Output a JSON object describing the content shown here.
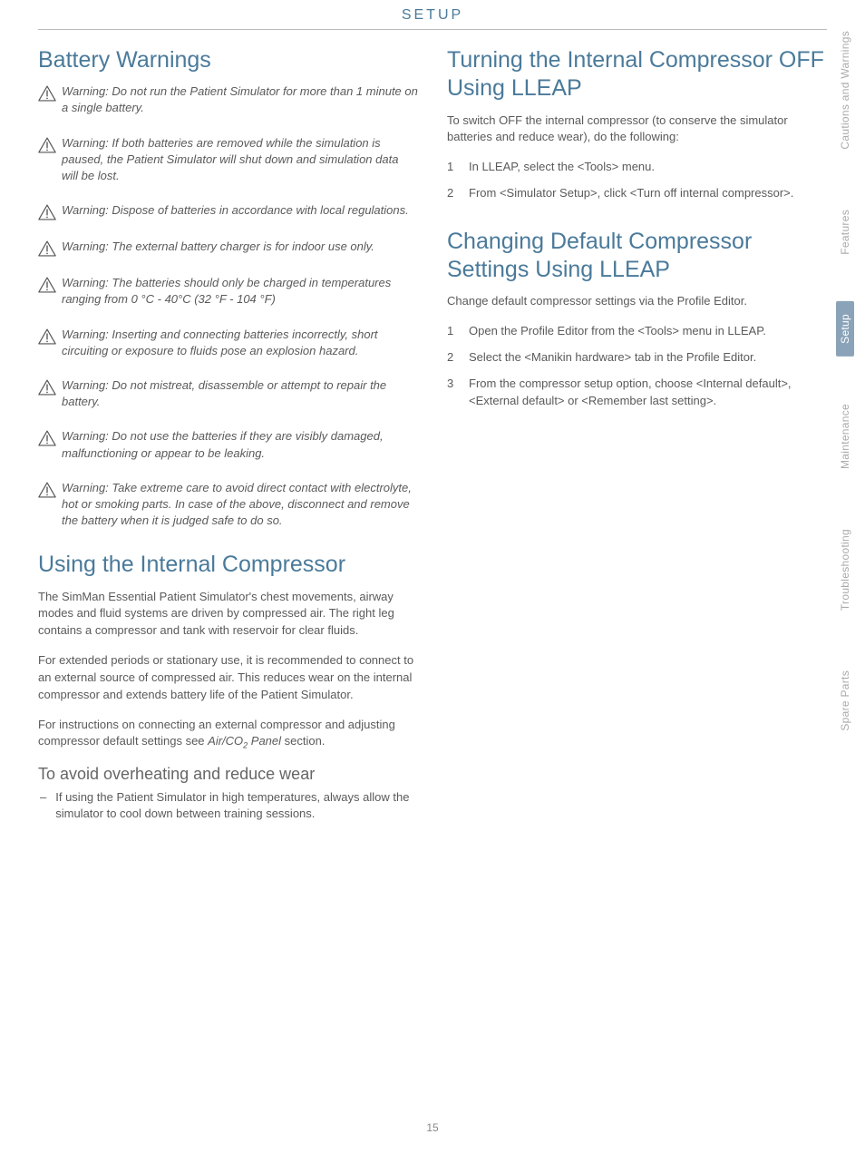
{
  "header": "SETUP",
  "page_number": "15",
  "side_tabs": [
    {
      "label": "Cautions and Warnings",
      "active": false
    },
    {
      "label": "Features",
      "active": false
    },
    {
      "label": "Setup",
      "active": true
    },
    {
      "label": "Maintenance",
      "active": false
    },
    {
      "label": "Troubleshooting",
      "active": false
    },
    {
      "label": "Spare Parts",
      "active": false
    }
  ],
  "left": {
    "h_battery": "Battery Warnings",
    "warnings": [
      "Warning: Do not run the Patient Simulator for more than 1 minute on a single battery.",
      "Warning: If both batteries are removed while the simulation is paused, the Patient Simulator will shut down and simulation data will be lost.",
      "Warning: Dispose of batteries in accordance with local regulations.",
      "Warning: The external battery charger is for indoor use only.",
      "Warning: The batteries should only be charged in temperatures ranging from 0 °C - 40°C (32 °F - 104 °F)",
      "Warning: Inserting and connecting batteries incorrectly, short circuiting or exposure to fluids pose an explosion hazard.",
      "Warning: Do not mistreat, disassemble or attempt to repair the battery.",
      "Warning: Do not use the batteries if they are visibly damaged, malfunctioning or appear to be leaking.",
      "Warning: Take extreme care to avoid direct contact with electrolyte, hot or smoking parts.  In case of the above, disconnect and remove the battery when it is judged safe to do so."
    ],
    "h_internal": "Using the Internal Compressor",
    "p1": "The SimMan Essential Patient Simulator's chest movements, airway modes and fluid systems are driven by compressed air. The right leg contains a compressor and tank with reservoir for clear fluids.",
    "p2": "For extended periods or stationary use, it is recommended to connect to an external source of compressed air. This reduces wear on the internal compressor and extends battery life of the Patient Simulator.",
    "p3_pre": "For instructions on connecting an external compressor and adjusting compressor default settings see ",
    "p3_em": "Air/CO",
    "p3_sub": "2",
    "p3_em2": " Panel",
    "p3_post": " section.",
    "h_overheat": "To avoid overheating and reduce wear",
    "overheat_item": "If using the Patient Simulator in high temperatures, always allow the simulator to cool down between training sessions."
  },
  "right": {
    "h_turning": "Turning the Internal Compressor OFF Using LLEAP",
    "turning_intro": "To switch OFF the internal compressor (to conserve the simulator batteries and reduce wear), do the following:",
    "turning_steps": [
      "In LLEAP, select the <Tools> menu.",
      "From <Simulator Setup>, click <Turn off internal compressor>."
    ],
    "h_changing": "Changing Default Compressor Settings Using LLEAP",
    "changing_intro": "Change default compressor settings via the Profile Editor.",
    "changing_steps": [
      "Open the Profile Editor from the <Tools> menu in LLEAP.",
      "Select the <Manikin hardware> tab in the Profile Editor.",
      "From the compressor setup option, choose <Internal default>, <External default> or <Remember last setting>."
    ]
  }
}
